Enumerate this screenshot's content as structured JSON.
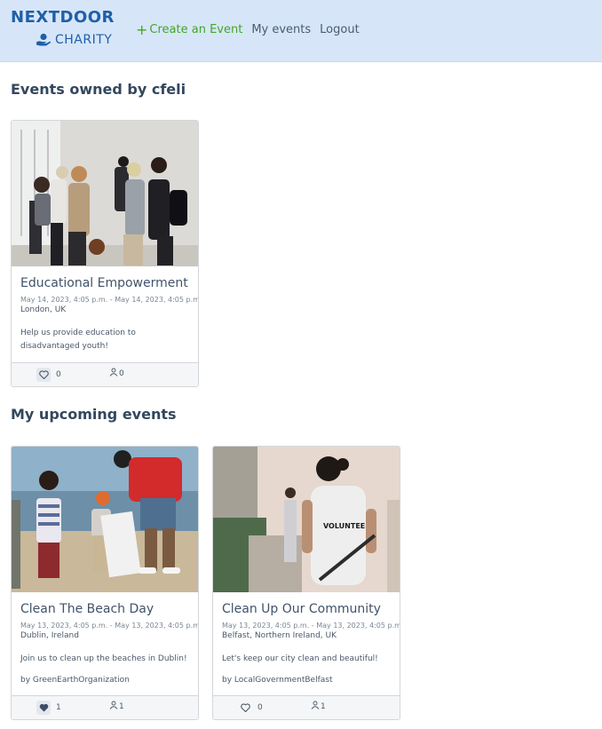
{
  "navbar": {
    "brand_top": "NEXTDOOR",
    "brand_bottom": "CHARITY",
    "brand_icon": "hand-heart-icon",
    "create_label": "Create an Event",
    "my_events_label": "My events",
    "logout_label": "Logout",
    "colors": {
      "background": "#d6e6f8",
      "brand": "#1f5fa8",
      "create": "#43a527"
    }
  },
  "owned": {
    "heading": "Events owned by cfeli",
    "events": [
      {
        "title": "Educational Empowerment",
        "dates": "May 14, 2023, 4:05 p.m. - May 14, 2023, 4:05 p.m.",
        "location": "London, UK",
        "description": "Help us provide education to disadvantaged youth!",
        "likes": "0",
        "attendees": "0",
        "liked": false
      }
    ]
  },
  "upcoming": {
    "heading": "My upcoming events",
    "events": [
      {
        "title": "Clean The Beach Day",
        "dates": "May 13, 2023, 4:05 p.m. - May 13, 2023, 4:05 p.m.",
        "location": "Dublin, Ireland",
        "description": "Join us to clean up the beaches in Dublin!",
        "organizer": "by GreenEarthOrganization",
        "likes": "1",
        "attendees": "1",
        "liked": true
      },
      {
        "title": "Clean Up Our Community",
        "dates": "May 13, 2023, 4:05 p.m. - May 13, 2023, 4:05 p.m.",
        "location": "Belfast, Northern Ireland, UK",
        "description": "Let's keep our city clean and beautiful!",
        "organizer": "by LocalGovernmentBelfast",
        "likes": "0",
        "attendees": "1",
        "liked": false
      }
    ]
  },
  "photo_caption": "VOLUNTEER"
}
